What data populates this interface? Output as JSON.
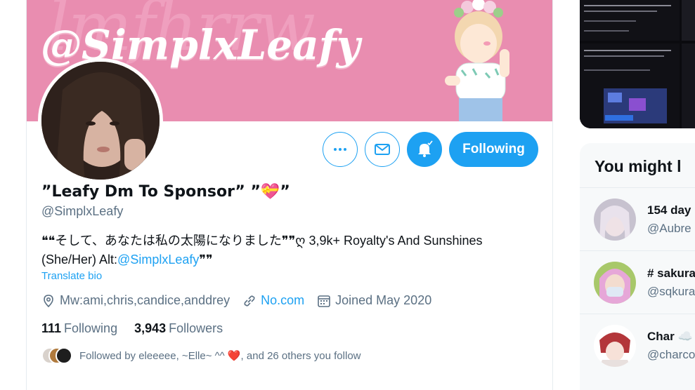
{
  "banner": {
    "handle_text": "@SimplxLeafy",
    "background_text": "lmfhrrw",
    "color": "#e98db0"
  },
  "profile": {
    "display_name": "”Leafy Dm To Sponsor” ”💝”",
    "handle": "@SimplxLeafy",
    "bio_text": "❝❝そして、あなたは私の太陽になりました❞❞ღ 3,9k+ Royalty's And Sunshines (She/Her) Alt:",
    "bio_link": "@SimplxLeafy",
    "bio_tail": "❞❞",
    "translate_label": "Translate bio",
    "location": "Mw:ami,chris,candice,anddrey",
    "website": "No.com",
    "joined": "Joined May 2020",
    "following_count": "111",
    "following_label": "Following",
    "followers_count": "3,943",
    "followers_label": "Followers",
    "followed_by_text": "Followed by eleeeee, ~Elle~ ^^ ❤️, and 26 others you follow"
  },
  "actions": {
    "more_icon": "more-dots-icon",
    "message_icon": "envelope-icon",
    "notify_icon": "bell-icon",
    "follow_label": "Following"
  },
  "sidebar": {
    "who_to_follow_title": "You might l",
    "users": [
      {
        "name": "154 day",
        "handle": "@Aubre"
      },
      {
        "name": "# sakura",
        "handle": "@sqkura"
      },
      {
        "name": "Char ☁️",
        "handle": "@charco"
      }
    ]
  },
  "colors": {
    "accent": "#1da1f2",
    "muted": "#5b7083",
    "text": "#0f1419"
  }
}
